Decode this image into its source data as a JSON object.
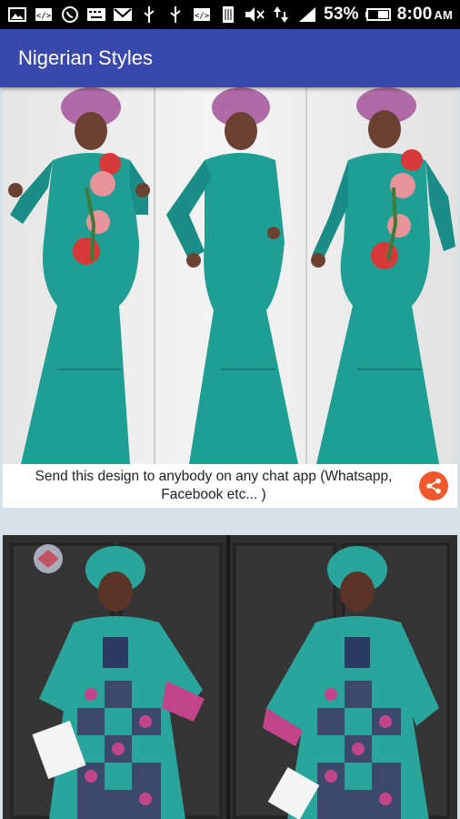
{
  "status_bar": {
    "left_icons": [
      "photo-icon",
      "code-icon",
      "whatsapp-icon",
      "keyboard-icon",
      "mail-icon",
      "usb-icon",
      "usb-icon",
      "code-icon",
      "sim-icon"
    ],
    "right_icons": [
      "mute-icon",
      "data-arrows-icon",
      "signal-icon",
      "battery-icon"
    ],
    "battery": "53%",
    "time": "8:00",
    "ampm": "AM"
  },
  "app_bar": {
    "title": "Nigerian Styles"
  },
  "cards": [
    {
      "image": "three-views-teal-lace-mermaid-gown-with-floral-appliques",
      "share_text_line1": "Send this design to anybody on any chat app (Whatsapp,",
      "share_text_line2": "Facebook etc... )",
      "share_icon": "share-icon"
    },
    {
      "image": "two-views-teal-lace-and-ankara-patchwork-dress-with-flared-sleeves"
    }
  ],
  "colors": {
    "app_bar": "#3949ab",
    "status_bar": "#000000",
    "share_button": "#f2582e",
    "feed_background": "#d6e2e8",
    "dress_teal": "#1f9e94"
  }
}
